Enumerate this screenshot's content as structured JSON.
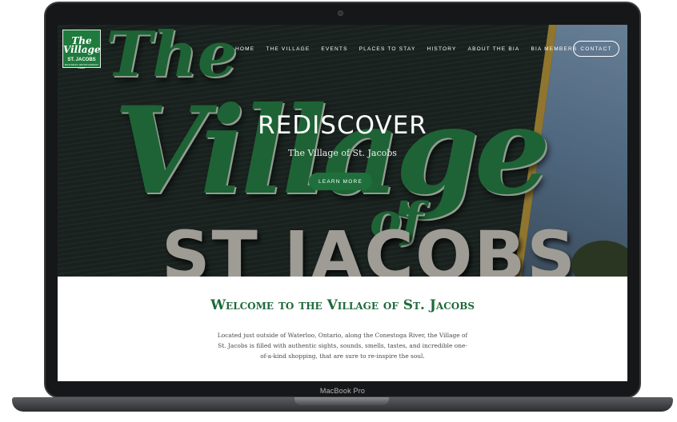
{
  "device": {
    "model_label": "MacBook Pro"
  },
  "logo": {
    "script": "The Village",
    "name": "ST. JACOBS",
    "sub": "BUSINESS IMPROVEMENT AREA"
  },
  "nav": {
    "items": [
      "HOME",
      "THE VILLAGE",
      "EVENTS",
      "PLACES TO STAY",
      "HISTORY",
      "ABOUT THE BIA",
      "BIA MEMBERS"
    ],
    "contact_label": "CONTACT"
  },
  "hero": {
    "title": "REDISCOVER",
    "subtitle": "The Village of St. Jacobs",
    "button_label": "LEARN MORE",
    "sign_text": {
      "the": "The",
      "village": "Village",
      "of": "of",
      "jacobs": "ST JACOBS"
    }
  },
  "welcome": {
    "title": "Welcome to the Village of St. Jacobs",
    "body": "Located just outside of Waterloo, Ontario, along the Conestoga River, the Village of St. Jacobs is filled with authentic sights, sounds, smells, tastes, and incredible one-of-a-kind shopping, that are sure to re-inspire the soul."
  },
  "colors": {
    "brand_green": "#1e6f3c",
    "heading_green": "#1e6a3a"
  }
}
